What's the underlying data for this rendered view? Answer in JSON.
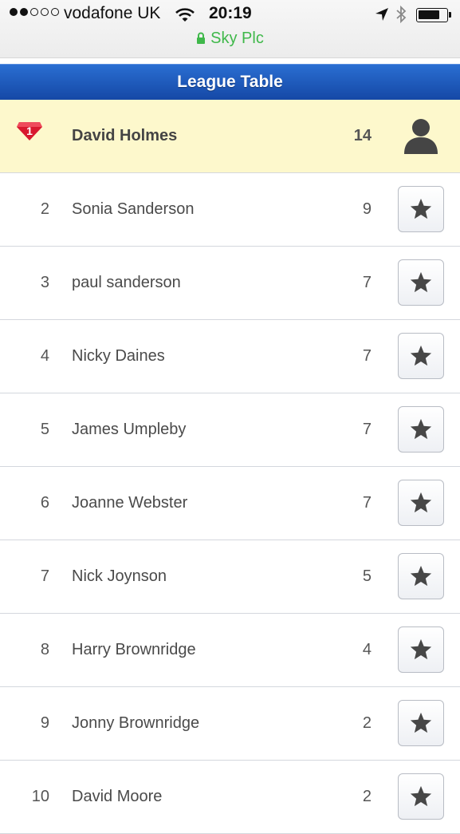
{
  "status_bar": {
    "carrier": "vodafone UK",
    "time": "20:19",
    "site": "Sky Plc",
    "signal_bars": 2
  },
  "header": {
    "title": "League Table"
  },
  "leader": {
    "rank": "1",
    "name": "David Holmes",
    "points": "14",
    "icon": "user-icon"
  },
  "rows": [
    {
      "rank": "2",
      "name": "Sonia Sanderson",
      "points": "9"
    },
    {
      "rank": "3",
      "name": "paul sanderson",
      "points": "7"
    },
    {
      "rank": "4",
      "name": "Nicky Daines",
      "points": "7"
    },
    {
      "rank": "5",
      "name": "James Umpleby",
      "points": "7"
    },
    {
      "rank": "6",
      "name": "Joanne Webster",
      "points": "7"
    },
    {
      "rank": "7",
      "name": "Nick Joynson",
      "points": "5"
    },
    {
      "rank": "8",
      "name": "Harry Brownridge",
      "points": "4"
    },
    {
      "rank": "9",
      "name": "Jonny Brownridge",
      "points": "2"
    },
    {
      "rank": "10",
      "name": "David Moore",
      "points": "2"
    }
  ],
  "colors": {
    "header_blue": "#1f5cc0",
    "leader_bg": "#fdf8cc",
    "secure_green": "#3fb84a",
    "medal_red": "#d8192f"
  }
}
